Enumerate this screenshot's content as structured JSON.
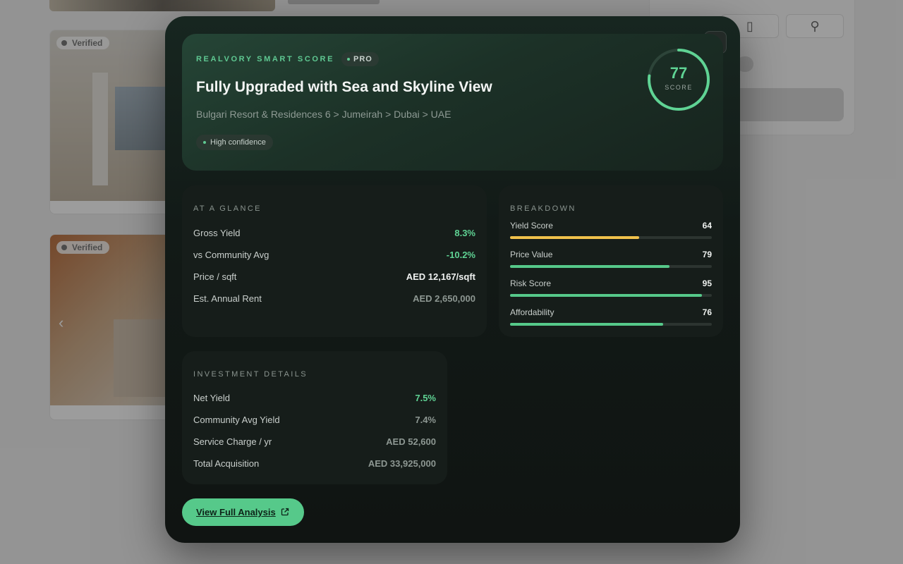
{
  "background": {
    "verified_badge": "Verified"
  },
  "modal": {
    "close_icon": "close-icon",
    "hero": {
      "eyebrow": "REALVORY SMART SCORE",
      "pro_badge": "PRO",
      "title": "Fully Upgraded with Sea and Skyline View",
      "location_path": "Bulgari Resort & Residences 6 > Jumeirah > Dubai > UAE",
      "confidence": "High confidence",
      "score": {
        "value": "77",
        "label": "SCORE",
        "fraction": 0.77,
        "color": "#5fd394"
      }
    },
    "at_a_glance": {
      "heading": "AT A GLANCE",
      "rows": [
        {
          "label": "Gross Yield",
          "value": "8.3%",
          "tone": "green"
        },
        {
          "label": "vs Community Avg",
          "value": "-10.2%",
          "tone": "green"
        },
        {
          "label": "Price / sqft",
          "value": "AED 12,167/sqft",
          "tone": "white"
        },
        {
          "label": "Est. Annual Rent",
          "value": "AED 2,650,000",
          "tone": "grey"
        }
      ]
    },
    "breakdown": {
      "heading": "BREAKDOWN",
      "items": [
        {
          "label": "Yield Score",
          "value": "64",
          "level": 0.64,
          "color": "#f0c14b"
        },
        {
          "label": "Price Value",
          "value": "79",
          "level": 0.79,
          "color": "#56c98a"
        },
        {
          "label": "Risk Score",
          "value": "95",
          "level": 0.95,
          "color": "#56c98a"
        },
        {
          "label": "Affordability",
          "value": "76",
          "level": 0.76,
          "color": "#56c98a"
        }
      ]
    },
    "investment_details": {
      "heading": "INVESTMENT DETAILS",
      "rows": [
        {
          "label": "Net Yield",
          "value": "7.5%",
          "tone": "green"
        },
        {
          "label": "Community Avg Yield",
          "value": "7.4%",
          "tone": "grey"
        },
        {
          "label": "Service Charge / yr",
          "value": "AED 52,600",
          "tone": "grey"
        },
        {
          "label": "Total Acquisition",
          "value": "AED 33,925,000",
          "tone": "grey"
        }
      ]
    },
    "cta": {
      "label": "View Full Analysis",
      "icon": "external-link-icon"
    }
  }
}
